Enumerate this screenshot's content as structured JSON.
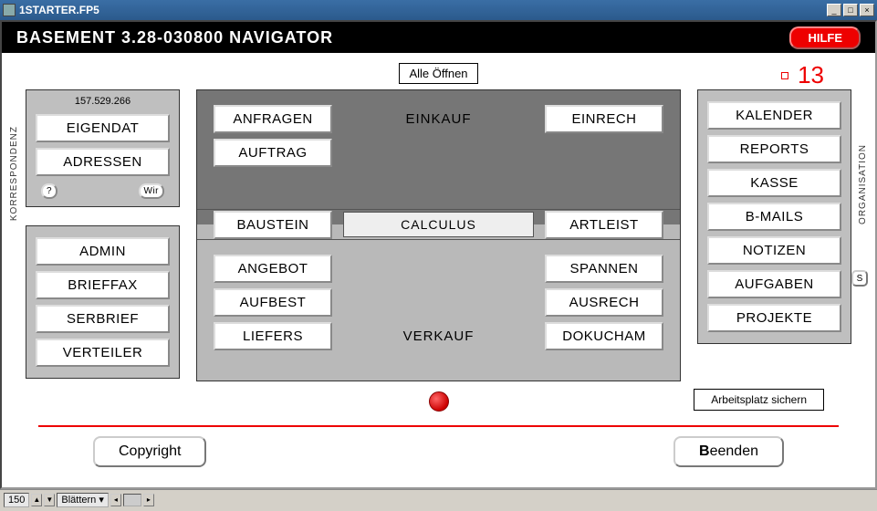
{
  "window": {
    "title": "1STARTER.FP5"
  },
  "header": {
    "title": "BASEMENT 3.28-030800 NAVIGATOR",
    "help": "HILFE"
  },
  "top": {
    "alle_offnen": "Alle Öffnen",
    "number": "13"
  },
  "left": {
    "vlabel": "KORRESPONDENZ",
    "header_num": "157.529.266",
    "group1": {
      "eigendat": "EIGENDAT",
      "adressen": "ADRESSEN",
      "q": "?",
      "wir": "Wir"
    },
    "group2": {
      "admin": "ADMIN",
      "brieffax": "BRIEFFAX",
      "serbrief": "SERBRIEF",
      "verteiler": "VERTEILER"
    }
  },
  "center": {
    "einkauf_label": "EINKAUF",
    "verkauf_label": "VERKAUF",
    "top": {
      "anfragen": "ANFRAGEN",
      "einrech": "EINRECH",
      "auftrag": "AUFTRAG"
    },
    "mid": {
      "baustein": "BAUSTEIN",
      "calculus": "CALCULUS",
      "artleist": "ARTLEIST"
    },
    "bottom": {
      "angebot": "ANGEBOT",
      "spannen": "SPANNEN",
      "aufbest": "AUFBEST",
      "ausrech": "AUSRECH",
      "liefers": "LIEFERS",
      "dokucham": "DOKUCHAM"
    }
  },
  "right": {
    "vlabel": "ORGANISATION",
    "kalender": "KALENDER",
    "reports": "REPORTS",
    "kasse": "KASSE",
    "bmails": "B-MAILS",
    "notizen": "NOTIZEN",
    "aufgaben": "AUFGABEN",
    "projekte": "PROJEKTE",
    "s_label": "S"
  },
  "below": {
    "arbeitsplatz": "Arbeitsplatz sichern"
  },
  "footer": {
    "copyright": "Copyright",
    "beenden": "Beenden"
  },
  "status": {
    "zoom": "150",
    "mode": "Blättern"
  }
}
